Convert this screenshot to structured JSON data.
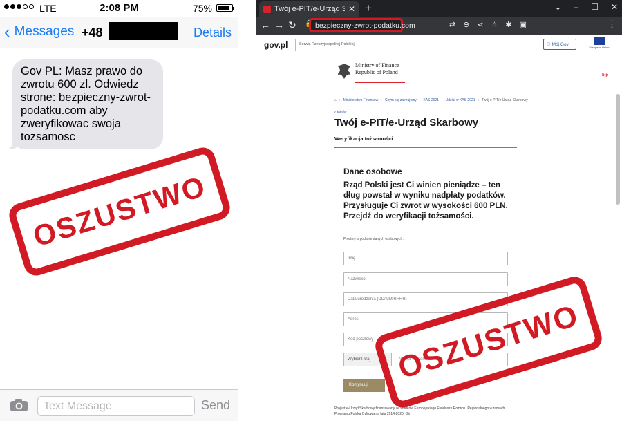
{
  "phone": {
    "status": {
      "carrier": "LTE",
      "time": "2:08 PM",
      "battery": "75%"
    },
    "nav": {
      "back_label": "Messages",
      "number": "+48",
      "details_label": "Details"
    },
    "message": "Gov PL: Masz prawo do zwrotu 600 zl. Odwiedz strone: bezpieczny-zwrot-podatku.com aby zweryfikowac swoja tozsamosc",
    "composer": {
      "placeholder": "Text Message",
      "send_label": "Send"
    },
    "stamp": "OSZUSTWO"
  },
  "browser": {
    "tab_title": "Twój e-PIT/e-Urząd Skarbowy",
    "url": "bezpieczny-zwrot-podatku.com",
    "site": {
      "logo": "gov.pl",
      "service": "Serwis Rzeczypospolitej Polskiej",
      "my_gov": "Mój Gov",
      "eu_caption": "European Union",
      "ministry_line1": "Ministry of Finance",
      "ministry_line2": "Republic of Poland",
      "bip": "bip",
      "breadcrumbs": [
        "Ministerstwo Finansów",
        "Czym się zajmujemy",
        "KAS 2021",
        "Udział w KAS 2021",
        "Twój e-PIT/e-Urząd Skarbowy"
      ],
      "back": "Wróć",
      "title": "Twój e-PIT/e-Urząd Skarbowy",
      "subtitle": "Weryfikacja tożsamości",
      "section_title": "Dane osobowe",
      "lead": "Rząd Polski jest Ci winien pieniądze – ten dług powstał w wyniku nadpłaty podatków. Przysługuje Ci zwrot w wysokości 600 PLN. Przejdź do weryfikacji tożsamości.",
      "hint": "Prosimy o podanie danych osobowych.",
      "fields": {
        "first_name": "Imię",
        "last_name": "Nazwisko",
        "birth_date": "Data urodzenia (DD/MM/RRRR)",
        "address": "Adres",
        "postal_code": "Kod pocztowy",
        "country": "Wybierz kraj",
        "phone": "Numer telefonu"
      },
      "submit": "Kontynuuj",
      "footer": "Projekt e-Urząd Skarbowy finansowany ze środków Europejskiego Funduszu Rozwoju Regionalnego w ramach Programu Polska Cyfrowa na lata 2014-2020. Oś"
    },
    "stamp": "OSZUSTWO"
  },
  "colors": {
    "stamp_red": "#d11a24",
    "ios_blue": "#1a7cf6",
    "gov_gold": "#9b8a63"
  }
}
